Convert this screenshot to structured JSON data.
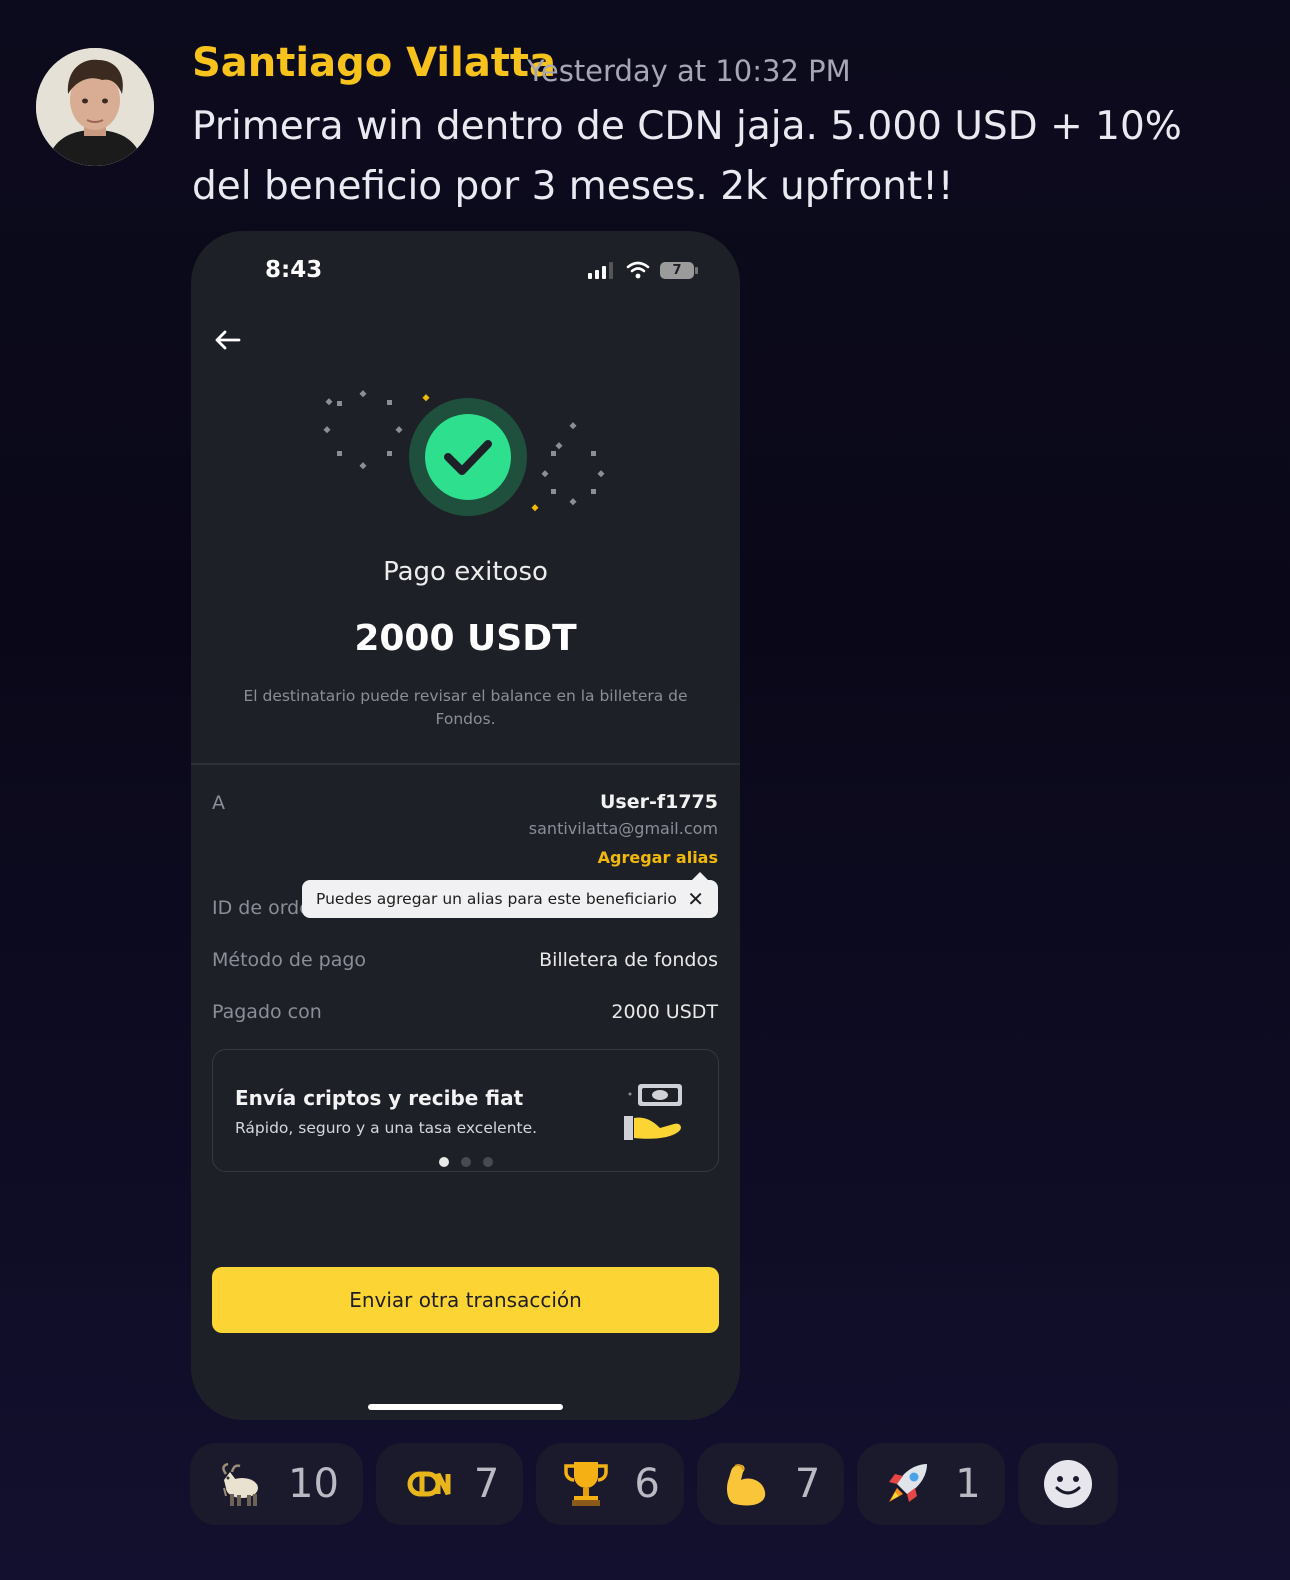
{
  "message": {
    "author": "Santiago Vilatta",
    "timestamp": "Yesterday at 10:32 PM",
    "text": "Primera win dentro de CDN jaja. 5.000 USD + 10% del beneficio por 3 meses. 2k upfront!!"
  },
  "phone": {
    "status": {
      "time": "8:43",
      "battery": "7"
    },
    "payment": {
      "title": "Pago exitoso",
      "amount": "2000 USDT",
      "note": "El destinatario puede revisar el balance en la billetera de Fondos."
    },
    "details": {
      "to_label": "A",
      "recipient_name": "User-f1775",
      "recipient_email": "santivilatta@gmail.com",
      "add_alias": "Agregar alias",
      "order_label": "ID de orde",
      "method_label": "Método de pago",
      "method_value": "Billetera de fondos",
      "paid_label": "Pagado con",
      "paid_value": "2000 USDT"
    },
    "tooltip": {
      "text": "Puedes agregar un alias para este beneficiario",
      "close": "✕"
    },
    "promo": {
      "title": "Envía criptos y recibe fiat",
      "subtitle": "Rápido, seguro y a una tasa excelente.",
      "active_page": 1,
      "pages": 3
    },
    "cta_label": "Enviar otra transacción"
  },
  "reactions": [
    {
      "icon": "goat-icon",
      "count": "10"
    },
    {
      "icon": "cdn-logo-icon",
      "count": "7"
    },
    {
      "icon": "trophy-icon",
      "count": "6"
    },
    {
      "icon": "flexed-biceps-icon",
      "count": "7"
    },
    {
      "icon": "rocket-icon",
      "count": "1"
    }
  ],
  "colors": {
    "author": "#f7c21b",
    "accent_yellow": "#fcd535",
    "success_green": "#2ee08d",
    "phone_bg": "#1e2027"
  }
}
